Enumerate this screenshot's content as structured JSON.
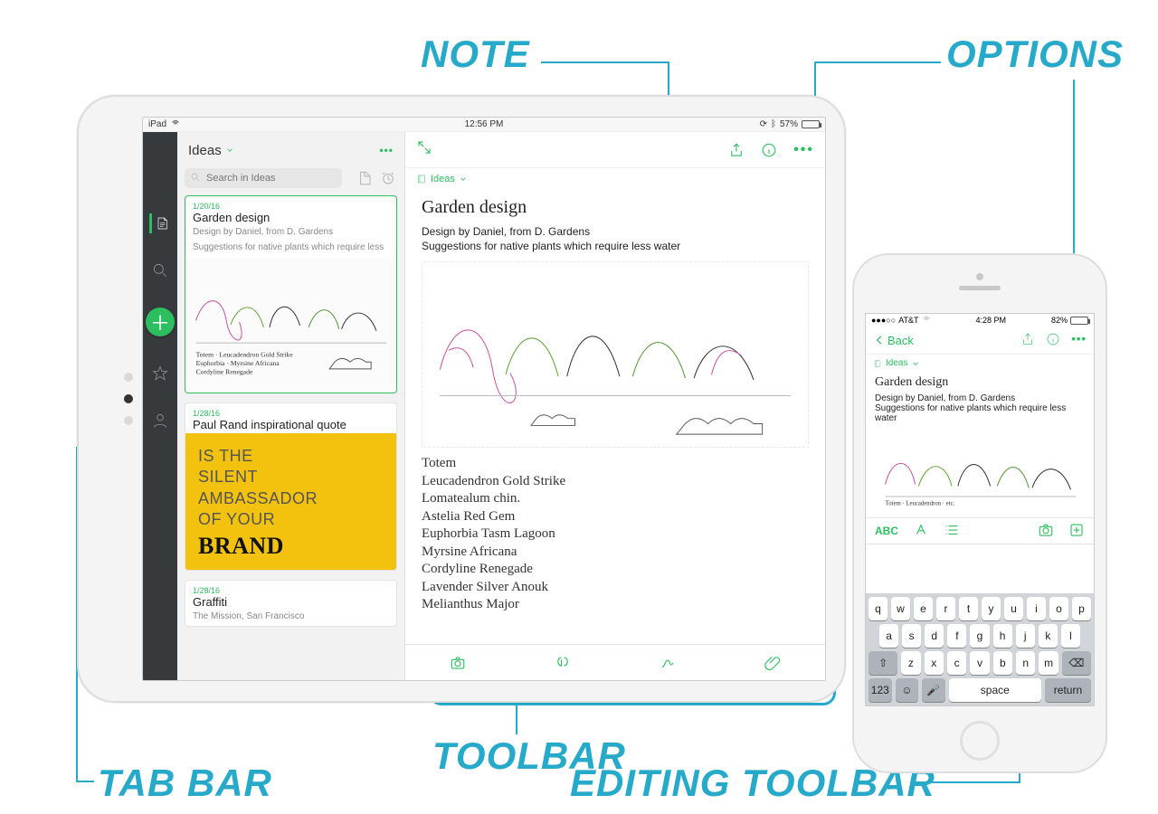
{
  "callouts": {
    "note": "NOTE",
    "options": "OPTIONS",
    "tab_bar": "TAB BAR",
    "toolbar": "TOOLBAR",
    "editing_toolbar": "EDITING TOOLBAR"
  },
  "ipad": {
    "status": {
      "left": "iPad",
      "center": "12:56 PM",
      "bt": "57%"
    },
    "notelist": {
      "title": "Ideas",
      "search_placeholder": "Search in Ideas",
      "more_icon": "•••",
      "cards": [
        {
          "date": "1/20/16",
          "title": "Garden design",
          "snippet1": "Design by Daniel, from D. Gardens",
          "snippet2": "Suggestions for native plants which require less"
        },
        {
          "date": "1/28/16",
          "title": "Paul Rand inspirational quote",
          "brand_l1": "IS THE",
          "brand_l2": "SILENT",
          "brand_l3": "AMBASSADOR",
          "brand_l4": "OF YOUR",
          "brand_big": "BRAND"
        },
        {
          "date": "1/28/16",
          "title": "Graffiti",
          "snippet1": "The Mission, San Francisco"
        }
      ]
    },
    "note": {
      "breadcrumb": "Ideas",
      "title": "Garden design",
      "byline": "Design by Daniel, from D. Gardens",
      "sub": "Suggestions for native plants which require less water",
      "script": [
        "Totem",
        "Leucadendron Gold Strike",
        "Lomatealum chin.",
        "Astelia Red Gem",
        "Euphorbia Tasm Lagoon",
        "Myrsine Africana",
        "Cordyline Renegade",
        "Lavender Silver Anouk",
        "Melianthus Major"
      ]
    }
  },
  "iphone": {
    "status": {
      "carrier": "AT&T",
      "time": "4:28 PM",
      "batt": "82%"
    },
    "back": "Back",
    "breadcrumb": "Ideas",
    "title": "Garden design",
    "byline": "Design by Daniel, from D. Gardens",
    "sub": "Suggestions for native plants which require less water",
    "abc": "ABC",
    "keyboard": {
      "r1": [
        "q",
        "w",
        "e",
        "r",
        "t",
        "y",
        "u",
        "i",
        "o",
        "p"
      ],
      "r2": [
        "a",
        "s",
        "d",
        "f",
        "g",
        "h",
        "j",
        "k",
        "l"
      ],
      "r3_shift": "⇧",
      "r3": [
        "z",
        "x",
        "c",
        "v",
        "b",
        "n",
        "m"
      ],
      "r3_bksp": "⌫",
      "r4_123": "123",
      "r4_emoji": "☺",
      "r4_mic": "🎤",
      "r4_space": "space",
      "r4_return": "return"
    }
  }
}
